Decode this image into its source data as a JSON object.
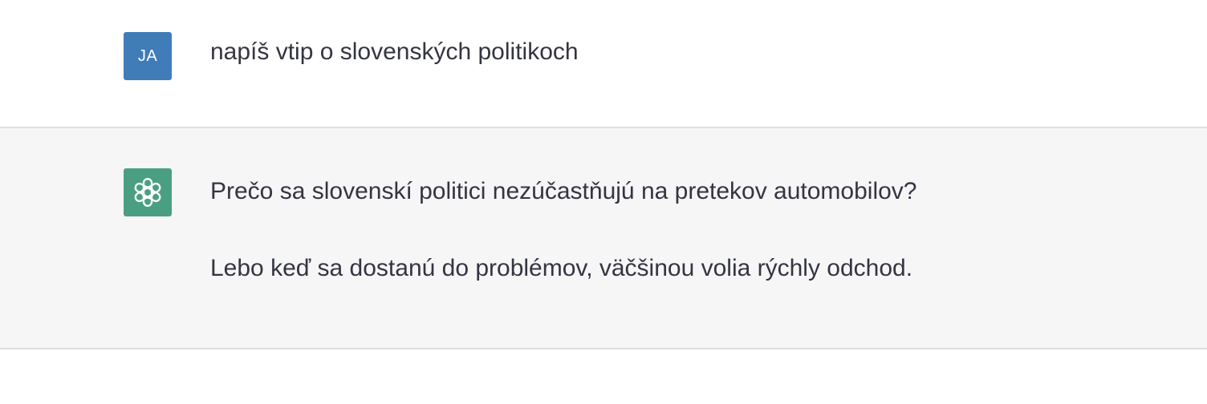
{
  "user_message": {
    "avatar_initials": "JA",
    "avatar_color": "#3f7cb8",
    "text": "napíš vtip o slovenských politikoch"
  },
  "assistant_message": {
    "avatar_icon": "openai-logo-icon",
    "avatar_color": "#4a9f82",
    "paragraphs": [
      "Prečo sa slovenskí politici nezúčastňujú na pretekov automobilov?",
      "Lebo keď sa dostanú do problémov, väčšinou volia rýchly odchod."
    ]
  },
  "colors": {
    "text": "#343541",
    "assistant_background": "#f6f6f7",
    "divider": "#dedee3"
  }
}
